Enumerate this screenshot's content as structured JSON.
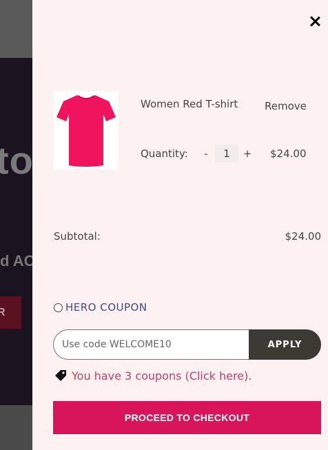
{
  "background": {
    "hero_text": "to",
    "sub_text": "d AC",
    "button_text": "R"
  },
  "cart": {
    "close_label": "×",
    "item": {
      "name": "Women Red T-shirt",
      "remove_label": "Remove",
      "quantity_label": "Quantity:",
      "minus_label": "-",
      "quantity": "1",
      "plus_label": "+",
      "price": "$24.00",
      "image_color": "#f0145f"
    },
    "subtotal_label": "Subtotal:",
    "subtotal_value": "$24.00",
    "coupon_option_label": "HERO COUPON",
    "coupon_input_placeholder": "Use code WELCOME10",
    "apply_label": "APPLY",
    "coupons_link_text": "You have 3 coupons (Click here).",
    "checkout_label": "PROCEED TO CHECKOUT"
  },
  "colors": {
    "drawer_bg": "#fdf1f2",
    "checkout_bg": "#d8155a",
    "apply_bg": "#3b3a33",
    "coupon_label": "#3e4a86",
    "coupons_link": "#c2416c"
  },
  "icons": {
    "close": "close-icon",
    "tag": "tag-icon",
    "product": "tshirt-image"
  }
}
